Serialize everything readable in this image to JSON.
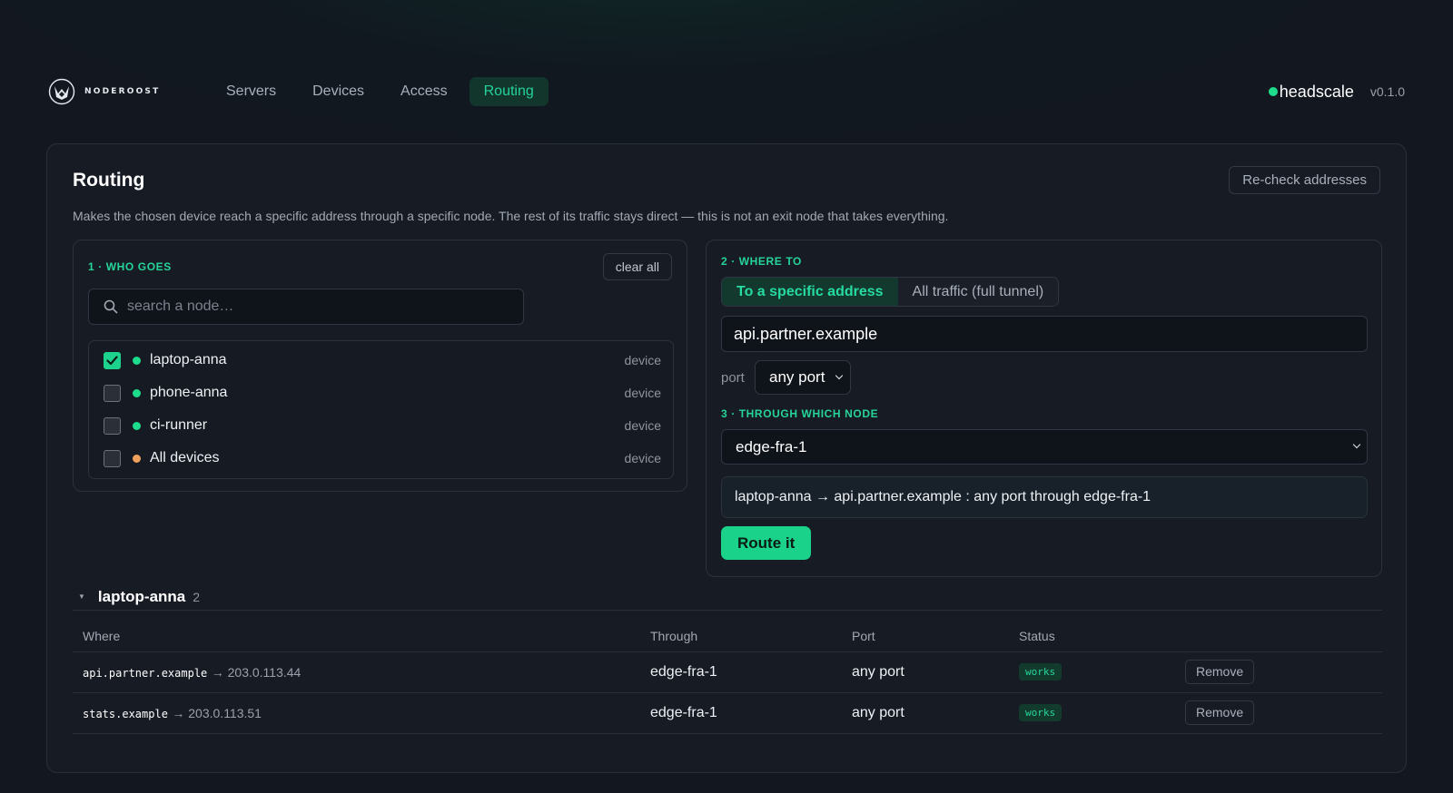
{
  "brand": {
    "name": "NODEROOST"
  },
  "nav": {
    "links": [
      {
        "label": "Servers",
        "active": false
      },
      {
        "label": "Devices",
        "active": false
      },
      {
        "label": "Access",
        "active": false
      },
      {
        "label": "Routing",
        "active": true
      }
    ],
    "server_name": "headscale",
    "version": "v0.1.0"
  },
  "page": {
    "title": "Routing",
    "recheck_label": "Re-check addresses",
    "description": "Makes the chosen device reach a specific address through a specific node. The rest of its traffic stays direct — this is not an exit node that takes everything."
  },
  "who": {
    "step_label": "1 · WHO GOES",
    "clear_label": "clear all",
    "search_placeholder": "search a node…",
    "nodes": [
      {
        "name": "laptop-anna",
        "type": "device",
        "checked": true,
        "status_color": "#1ddc8b"
      },
      {
        "name": "phone-anna",
        "type": "device",
        "checked": false,
        "status_color": "#1ddc8b"
      },
      {
        "name": "ci-runner",
        "type": "device",
        "checked": false,
        "status_color": "#1ddc8b"
      },
      {
        "name": "All devices",
        "type": "device",
        "checked": false,
        "status_color": "#f0a25c"
      }
    ]
  },
  "where": {
    "step_label": "2 · WHERE TO",
    "modes": [
      {
        "label": "To a specific address",
        "active": true
      },
      {
        "label": "All traffic (full tunnel)",
        "active": false
      }
    ],
    "address_value": "api.partner.example",
    "port_label": "port",
    "port_value": "any port"
  },
  "through": {
    "step_label": "3 · THROUGH WHICH NODE",
    "node_value": "edge-fra-1",
    "summary": "laptop-anna → api.partner.example : any port through edge-fra-1",
    "submit_label": "Route it"
  },
  "routes": {
    "group_name": "laptop-anna",
    "group_count": "2",
    "headers": [
      "Where",
      "Through",
      "Port",
      "Status"
    ],
    "rows": [
      {
        "host": "api.partner.example",
        "ip": "→ 203.0.113.44",
        "through": "edge-fra-1",
        "port": "any port",
        "status": "works",
        "action": "Remove"
      },
      {
        "host": "stats.example",
        "ip": "→ 203.0.113.51",
        "through": "edge-fra-1",
        "port": "any port",
        "status": "works",
        "action": "Remove"
      }
    ]
  },
  "colors": {
    "accent": "#1dd28c",
    "warning_dot": "#f0a25c",
    "background": "#12161e"
  }
}
